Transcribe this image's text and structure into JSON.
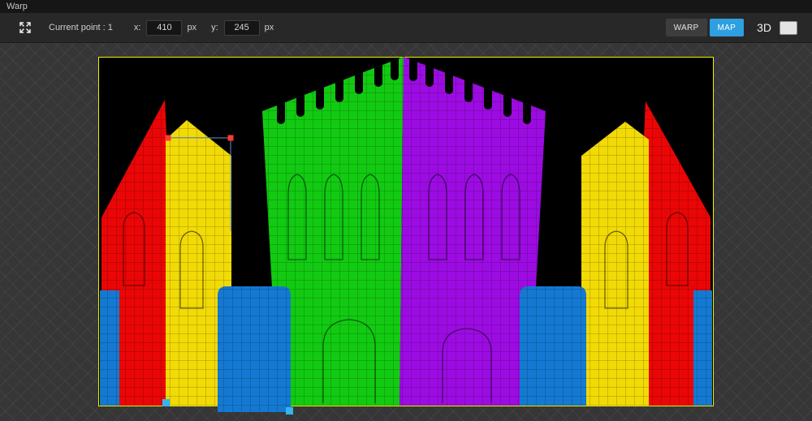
{
  "title_bar": {
    "title": "Warp"
  },
  "toolbar": {
    "current_point_label": "Current point : 1",
    "x_label": "x:",
    "x_value": "410",
    "x_unit": "px",
    "y_label": "y:",
    "y_value": "245",
    "y_unit": "px",
    "warp_button_label": "WARP",
    "map_button_label": "MAP",
    "mode_3d_label": "3D"
  },
  "icons": {
    "move_tool": "move-arrows-icon"
  },
  "colors": {
    "accent_blue": "#2e9fe0"
  },
  "canvas": {
    "border_color": "#f0f000",
    "background": "#000000",
    "surface_colors": {
      "red": "#ea0606",
      "yellow": "#f2da06",
      "green": "#12ca12",
      "purple": "#9c0ce2",
      "blue": "#1479d2"
    },
    "selection": {
      "handle_red": "#ff3b30",
      "handle_cyan": "#33b5f0",
      "line_blue": "#5a96d5"
    }
  }
}
